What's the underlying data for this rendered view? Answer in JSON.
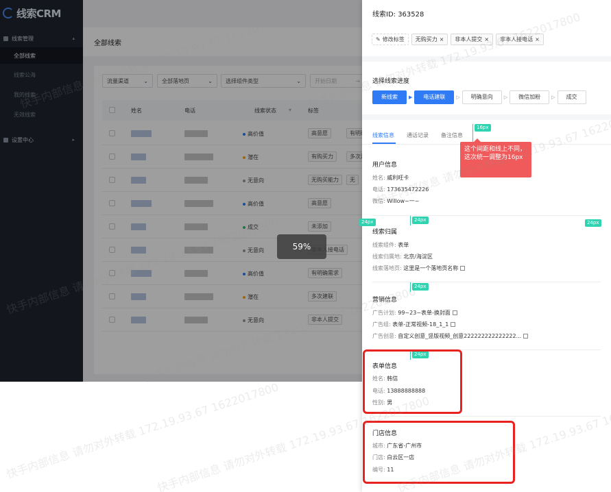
{
  "logo": "线索CRM",
  "nav": {
    "group1": "线索管理",
    "items": [
      "全部线索",
      "线索公海",
      "我的线索",
      "无效线索"
    ],
    "group2": "设置中心"
  },
  "main": {
    "title": "全部线索",
    "filters": [
      "流量渠道",
      "全部落地页",
      "选择组件类型",
      "开始日期"
    ],
    "columns": [
      "姓名",
      "电话",
      "线索状态",
      "标签"
    ],
    "rows": [
      {
        "status": "高价值",
        "color": "#2f7bf5",
        "tags": [
          "高意愿",
          "有明确需"
        ]
      },
      {
        "status": "潜在",
        "color": "#f5a623",
        "tags": [
          "有购买力",
          "多次建"
        ]
      },
      {
        "status": "无意向",
        "color": "#999999",
        "tags": [
          "无购买能力",
          "无"
        ]
      },
      {
        "status": "高价值",
        "color": "#2f7bf5",
        "tags": [
          "高意愿"
        ]
      },
      {
        "status": "成交",
        "color": "#3dbb6c",
        "tags": [
          "未添加"
        ]
      },
      {
        "status": "无意向",
        "color": "#999999",
        "tags": [
          "非本人接电话"
        ]
      },
      {
        "status": "高价值",
        "color": "#2f7bf5",
        "tags": [
          "有明确需求"
        ]
      },
      {
        "status": "潜在",
        "color": "#f5a623",
        "tags": [
          "多次建联"
        ]
      },
      {
        "status": "无意向",
        "color": "#999999",
        "tags": [
          "非本人提交"
        ]
      }
    ],
    "loading": "59%"
  },
  "drawer": {
    "title": "线索ID: 363528",
    "edit_tag": "修改标签",
    "tags": [
      "无购买力",
      "非本人提交",
      "非本人接电话"
    ],
    "progress_title": "选择线索进度",
    "steps": [
      "新线索",
      "电话建联",
      "明确意向",
      "微信加粉",
      "成交"
    ],
    "tabs": [
      "线索信息",
      "通话记录",
      "备注信息"
    ],
    "user": {
      "title": "用户信息",
      "name_k": "姓名:",
      "name_v": "威利旺卡",
      "phone_k": "电话:",
      "phone_v": "173635472226",
      "wx_k": "微信:",
      "wx_v": "Willow~一~"
    },
    "belong": {
      "title": "线索归属",
      "comp_k": "线索组件:",
      "comp_v": "表单",
      "place_k": "线索归属地:",
      "place_v": "北京/海淀区",
      "page_k": "线索落地页:",
      "page_v": "这里是一个落地页名称"
    },
    "ad": {
      "title": "营销信息",
      "plan_k": "广告计划:",
      "plan_v": "99~23~表单-换封面",
      "group_k": "广告组:",
      "group_v": "表单-正常视频-18_1_1",
      "idea_k": "广告创意:",
      "idea_v": "自定义创意_竖版视频_创意222222222222222..."
    },
    "form": {
      "title": "表单信息",
      "name_k": "姓名:",
      "name_v": "韩信",
      "phone_k": "电话:",
      "phone_v": "13888888888",
      "sex_k": "性别:",
      "sex_v": "男"
    },
    "store": {
      "title": "门店信息",
      "city_k": "城市:",
      "city_v": "广东省-广州市",
      "shop_k": "门店:",
      "shop_v": "白云区一店",
      "no_k": "编号:",
      "no_v": "11"
    }
  },
  "annotations": {
    "note": "这个间距和线上不同，这次统一调整为16px",
    "s16": "16px",
    "s24": "24px"
  },
  "watermark": "快手内部信息 请勿对外转载 172.19.93.67 1622017800"
}
